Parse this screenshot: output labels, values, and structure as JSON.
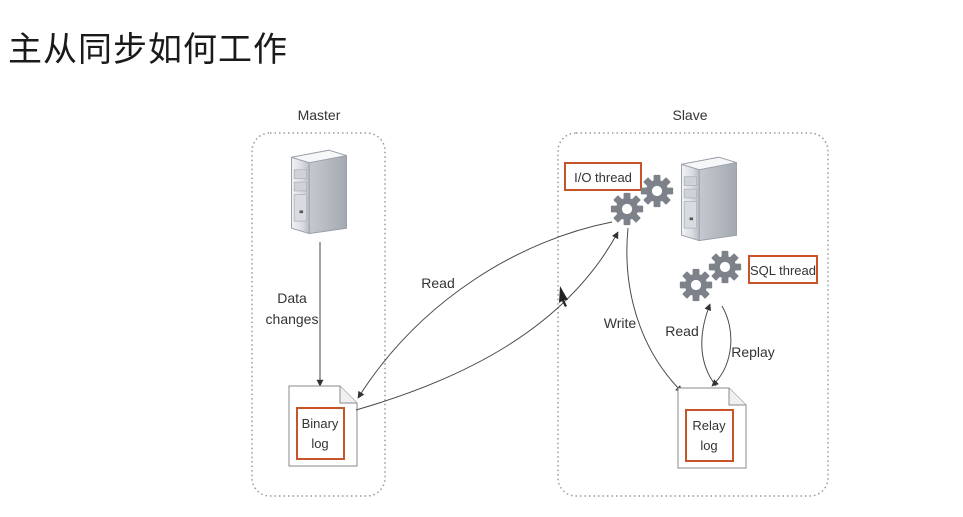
{
  "title": "主从同步如何工作",
  "master": {
    "label": "Master",
    "data_changes_line1": "Data",
    "data_changes_line2": "changes",
    "binary_log_line1": "Binary",
    "binary_log_line2": "log"
  },
  "slave": {
    "label": "Slave",
    "io_thread": "I/O thread",
    "sql_thread": "SQL thread",
    "relay_log_line1": "Relay",
    "relay_log_line2": "log",
    "write": "Write",
    "read": "Read",
    "replay": "Replay"
  },
  "link": {
    "read": "Read"
  },
  "colors": {
    "accent": "#c8552a",
    "gear": "#7d8189",
    "panel_border": "#9a9a9a"
  },
  "icons": {
    "server": "server-icon",
    "gear": "gear-icon",
    "document": "document-icon"
  }
}
